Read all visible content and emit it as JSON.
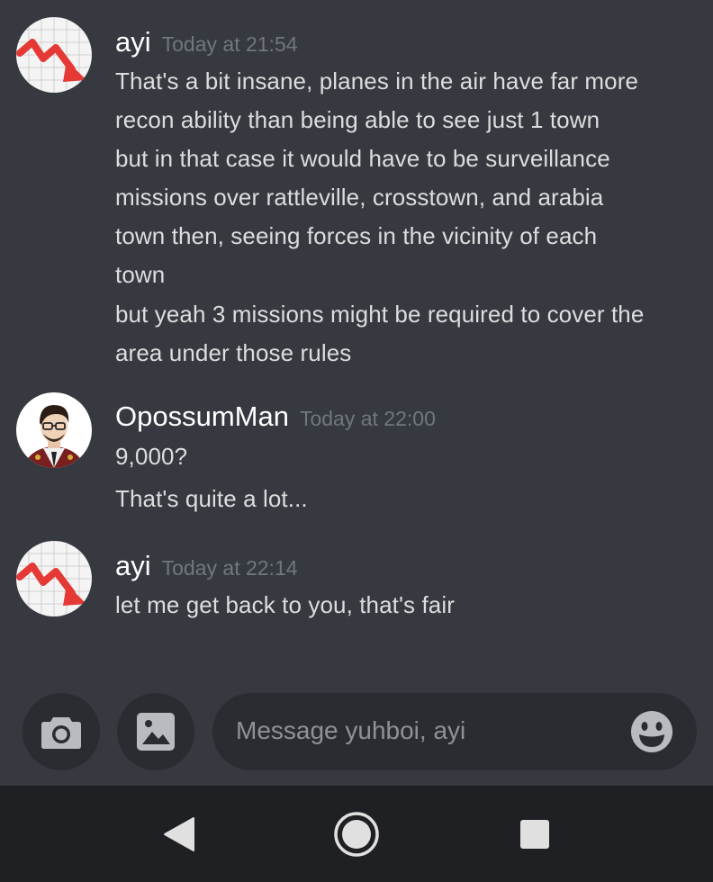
{
  "messages": [
    {
      "username": "ayi",
      "timestamp": "Today at 21:54",
      "lines": [
        "That's a bit insane, planes in the air have far more",
        "recon ability than being able to see just 1 town",
        "but in that case it would have to be surveillance",
        "missions over rattleville, crosstown, and arabia",
        "town then, seeing forces in the vicinity of each",
        "town",
        "but yeah 3 missions might be required to cover the",
        "area under those rules"
      ]
    },
    {
      "username": "OpossumMan",
      "timestamp": "Today at 22:00",
      "lines": [
        "9,000?",
        "That's quite a lot..."
      ]
    },
    {
      "username": "ayi",
      "timestamp": "Today at 22:14",
      "lines": [
        "let me get back to you, that's fair"
      ]
    }
  ],
  "composer": {
    "placeholder": "Message yuhboi, ayi",
    "camera_icon": "camera-icon",
    "gallery_icon": "image-icon",
    "emoji_icon": "emoji-icon"
  },
  "navbar": {
    "back_icon": "back-triangle-icon",
    "home_icon": "home-circle-icon",
    "recents_icon": "recents-square-icon"
  },
  "colors": {
    "background": "#36393f",
    "input_background": "#2a2c31",
    "navbar_background": "#1f2023",
    "username": "#ffffff",
    "timestamp": "#72767d",
    "message_text": "#dcddde",
    "avatar_arrow_red": "#e53935"
  }
}
